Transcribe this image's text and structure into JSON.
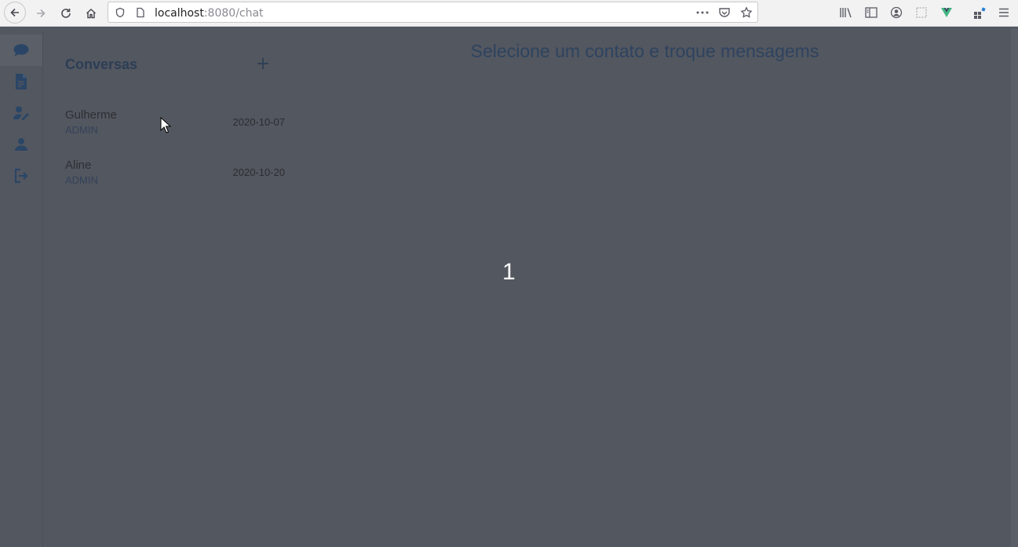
{
  "browser": {
    "url_host": "localhost",
    "url_path": ":8080/chat"
  },
  "rail": {
    "items": [
      {
        "id": "chat",
        "icon": "chat-bubble-icon",
        "active": true
      },
      {
        "id": "documents",
        "icon": "document-icon"
      },
      {
        "id": "user-edit",
        "icon": "user-edit-icon"
      },
      {
        "id": "profile",
        "icon": "user-icon"
      },
      {
        "id": "logout",
        "icon": "logout-icon"
      }
    ]
  },
  "conversations": {
    "title": "Conversas",
    "add_symbol": "+",
    "contacts": [
      {
        "name": "Gulherme",
        "role": "ADMIN",
        "date": "2020-10-07"
      },
      {
        "name": "Aline",
        "role": "ADMIN",
        "date": "2020-10-20"
      }
    ]
  },
  "main": {
    "title": "Selecione um contato e troque mensagems",
    "overlay_number": "1"
  },
  "colors": {
    "background": "#53575f",
    "title": "#2c3e56",
    "accent": "#2e4360"
  }
}
